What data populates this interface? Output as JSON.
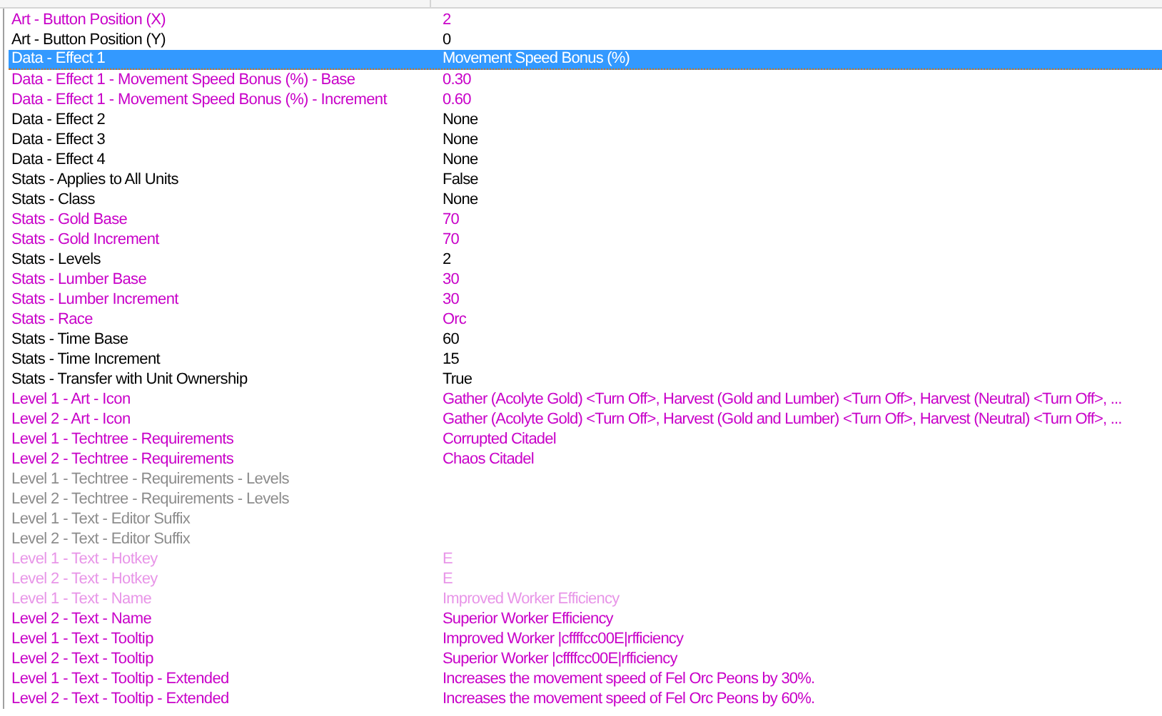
{
  "rows": [
    {
      "name": "Art - Button Position (X)",
      "value": "2",
      "kind": "modified",
      "selected": false
    },
    {
      "name": "Art - Button Position (Y)",
      "value": "0",
      "kind": "default",
      "selected": false
    },
    {
      "name": "Data - Effect 1",
      "value": "Movement Speed Bonus (%)",
      "kind": "default",
      "selected": true
    },
    {
      "name": "Data - Effect 1 - Movement Speed Bonus (%) - Base",
      "value": "0.30",
      "kind": "modified",
      "selected": false
    },
    {
      "name": "Data - Effect 1 - Movement Speed Bonus (%) - Increment",
      "value": "0.60",
      "kind": "modified",
      "selected": false
    },
    {
      "name": "Data - Effect 2",
      "value": "None",
      "kind": "default",
      "selected": false
    },
    {
      "name": "Data - Effect 3",
      "value": "None",
      "kind": "default",
      "selected": false
    },
    {
      "name": "Data - Effect 4",
      "value": "None",
      "kind": "default",
      "selected": false
    },
    {
      "name": "Stats - Applies to All Units",
      "value": "False",
      "kind": "default",
      "selected": false
    },
    {
      "name": "Stats - Class",
      "value": "None",
      "kind": "default",
      "selected": false
    },
    {
      "name": "Stats - Gold Base",
      "value": "70",
      "kind": "modified",
      "selected": false
    },
    {
      "name": "Stats - Gold Increment",
      "value": "70",
      "kind": "modified",
      "selected": false
    },
    {
      "name": "Stats - Levels",
      "value": "2",
      "kind": "default",
      "selected": false
    },
    {
      "name": "Stats - Lumber Base",
      "value": "30",
      "kind": "modified",
      "selected": false
    },
    {
      "name": "Stats - Lumber Increment",
      "value": "30",
      "kind": "modified",
      "selected": false
    },
    {
      "name": "Stats - Race",
      "value": "Orc",
      "kind": "modified",
      "selected": false
    },
    {
      "name": "Stats - Time Base",
      "value": "60",
      "kind": "default",
      "selected": false
    },
    {
      "name": "Stats - Time Increment",
      "value": "15",
      "kind": "default",
      "selected": false
    },
    {
      "name": "Stats - Transfer with Unit Ownership",
      "value": "True",
      "kind": "default",
      "selected": false
    },
    {
      "name": "Level 1 - Art - Icon",
      "value": "Gather (Acolyte Gold) <Turn Off>, Harvest (Gold and Lumber) <Turn Off>, Harvest (Neutral) <Turn Off>, ...",
      "kind": "modified",
      "selected": false
    },
    {
      "name": "Level 2 - Art - Icon",
      "value": "Gather (Acolyte Gold) <Turn Off>, Harvest (Gold and Lumber) <Turn Off>, Harvest (Neutral) <Turn Off>, ...",
      "kind": "modified",
      "selected": false
    },
    {
      "name": "Level 1 - Techtree - Requirements",
      "value": "Corrupted Citadel",
      "kind": "modified",
      "selected": false
    },
    {
      "name": "Level 2 - Techtree - Requirements",
      "value": "Chaos Citadel",
      "kind": "modified",
      "selected": false
    },
    {
      "name": "Level 1 - Techtree - Requirements - Levels",
      "kind": "disabled",
      "selected": false
    },
    {
      "name": "Level 2 - Techtree - Requirements - Levels",
      "kind": "disabled",
      "selected": false
    },
    {
      "name": "Level 1 - Text - Editor Suffix",
      "kind": "disabled",
      "selected": false
    },
    {
      "name": "Level 2 - Text - Editor Suffix",
      "kind": "disabled",
      "selected": false
    },
    {
      "name": "Level 1 - Text - Hotkey",
      "value": "E",
      "kind": "disabled_modified",
      "selected": false
    },
    {
      "name": "Level 2 - Text - Hotkey",
      "value": "E",
      "kind": "disabled_modified",
      "selected": false
    },
    {
      "name": "Level 1 - Text - Name",
      "value": "Improved Worker Efficiency",
      "kind": "disabled_modified",
      "selected": false
    },
    {
      "name": "Level 2 - Text - Name",
      "value": "Superior Worker Efficiency",
      "kind": "modified",
      "selected": false
    },
    {
      "name": "Level 1 - Text - Tooltip",
      "value": "Improved Worker |cffffcc00E|rfficiency",
      "kind": "modified",
      "selected": false
    },
    {
      "name": "Level 2 - Text - Tooltip",
      "value": "Superior Worker |cffffcc00E|rfficiency",
      "kind": "modified",
      "selected": false
    },
    {
      "name": "Level 1 - Text - Tooltip - Extended",
      "value": "Increases the movement speed of Fel Orc Peons by 30%.",
      "kind": "modified",
      "selected": false
    },
    {
      "name": "Level 2 - Text - Tooltip - Extended",
      "value": "Increases the movement speed of Fel Orc Peons by 60%.",
      "kind": "modified",
      "selected": false
    }
  ]
}
